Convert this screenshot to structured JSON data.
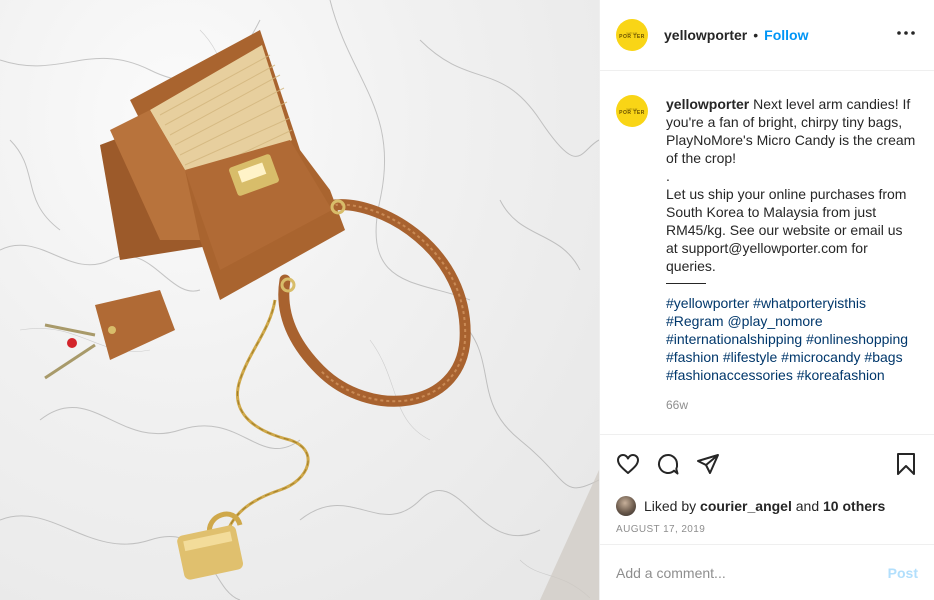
{
  "post": {
    "username": "yellowporter",
    "avatar_text_small": "yellow",
    "avatar_text_large": "POR TER",
    "follow_label": "Follow",
    "separator": "•",
    "more_icon": "more-horizontal-icon",
    "caption": {
      "intro": "Next level arm candies! If you're a fan of bright, chirpy tiny bags, PlayNoMore's Micro Candy is the cream of the crop!",
      "dot": ".",
      "body": "Let us ship your online purchases from South Korea to Malaysia from just RM45/kg. See our website or email us at support@yellowporter.com for queries.",
      "hashtags_line1": "#yellowporter #whatporteryisthis",
      "hashtags_line2": "#Regram @play_nomore",
      "hashtags_line3": "#internationalshipping #onlineshopping",
      "hashtags_line4": "#fashion #lifestyle #microcandy #bags",
      "hashtags_line5": "#fashionaccessories #koreafashion",
      "age": "66w"
    },
    "actions": {
      "like_icon": "heart-icon",
      "comment_icon": "comment-icon",
      "share_icon": "share-icon",
      "save_icon": "bookmark-icon"
    },
    "likes": {
      "prefix": "Liked by",
      "user": "courier_angel",
      "and": "and",
      "others": "10 others"
    },
    "date": "AUGUST 17, 2019",
    "comment": {
      "placeholder": "Add a comment...",
      "post_label": "Post"
    }
  },
  "colors": {
    "accent": "#0095f6",
    "avatar_bg": "#f9d516",
    "post_disabled": "#b2dffc"
  }
}
